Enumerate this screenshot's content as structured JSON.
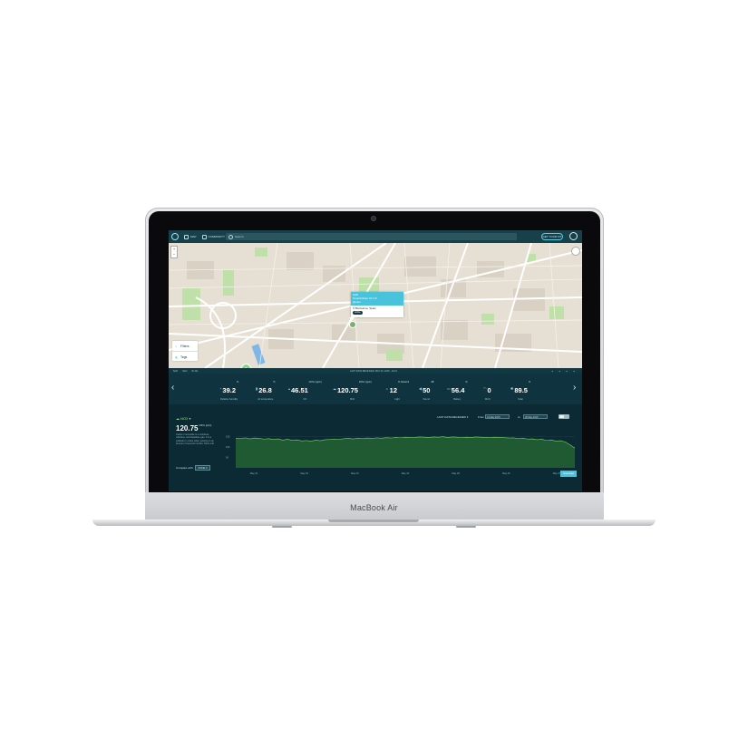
{
  "device": {
    "brand": "MacBook Air"
  },
  "app": {
    "nav": {
      "map_label": "MAP",
      "community_label": "COMMUNITY"
    },
    "search": {
      "placeholder": "Search"
    },
    "get_kit_label": "GET YOUR KIT",
    "colors": {
      "accent": "#49c2dc",
      "topbar": "#17404a",
      "panel": "#0b2a34",
      "chart_fill": "#1f5a33",
      "chart_line": "#7cd46a"
    }
  },
  "map": {
    "zoom_in": "+",
    "zoom_out": "−",
    "filters_label": "Filters",
    "tags_label": "Tags",
    "cluster_count": "6",
    "popup": {
      "name": "SoFi",
      "kit": "SmartCitizen Kit 1.5",
      "owner": "@user",
      "location": "Barcelona, Spain",
      "status": "online"
    }
  },
  "status_strip": {
    "left": [
      "SoFi",
      "SoFi",
      "ID 411"
    ],
    "center": "LAST DATA RECEIVED: MAY 20, 2015 - 10:21",
    "right": "▸ ▸ ▸ ▸"
  },
  "readings": [
    {
      "icon": "thermometer-icon",
      "value": "39.2",
      "unit": "%",
      "label": "Relative humidity"
    },
    {
      "icon": "temperature-icon",
      "value": "26.8",
      "unit": "°C",
      "label": "Air temperature"
    },
    {
      "icon": "co-icon",
      "value": "46.51",
      "unit": "kOhm (ppm)",
      "label": "CO"
    },
    {
      "icon": "no2-icon",
      "value": "120.75",
      "unit": "kOhm (ppm)",
      "label": "NO2"
    },
    {
      "icon": "light-icon",
      "value": "12",
      "unit": "% Network",
      "label": "Light"
    },
    {
      "icon": "sound-icon",
      "value": "50",
      "unit": "dB",
      "label": "Sound"
    },
    {
      "icon": "battery-icon",
      "value": "56.4",
      "unit": "%",
      "label": "Battery"
    },
    {
      "icon": "wifi-icon",
      "value": "0",
      "unit": "",
      "label": "Wi-Fi"
    },
    {
      "icon": "solar-icon",
      "value": "89.5",
      "unit": "%",
      "label": "Solar"
    }
  ],
  "detail": {
    "sensor_name": "NO2",
    "value": "120.75",
    "unit": "kOhm (ppm)",
    "description": "Carbon monoxide is a colorless, odorless, and tasteless gas. It is a pollutant in cities when existing in an amount of several months. More info",
    "compare_label": "Compare with:",
    "compare_value": "NONE",
    "range_label": "LAST DATA RECEIVED",
    "from_label": "From",
    "from_value": "21 May 2015",
    "to_label": "to",
    "to_value": "28 May 2015",
    "download_label": "Download"
  },
  "chart_data": {
    "type": "area",
    "x_ticks": [
      "May 21",
      "May 22",
      "May 23",
      "May 24",
      "May 25",
      "May 26",
      "May 27"
    ],
    "y_ticks": [
      "150",
      "100",
      "50"
    ],
    "ylim": [
      0,
      200
    ],
    "series": [
      {
        "values": [
          142,
          140,
          144,
          139,
          143,
          141,
          138,
          140,
          136,
          139,
          133,
          137,
          132,
          134,
          129,
          131,
          128,
          133,
          130,
          135,
          136,
          138,
          137,
          140,
          141,
          139,
          142,
          140,
          143,
          141,
          144,
          142,
          145,
          143,
          146,
          144,
          147,
          145,
          146,
          148,
          147,
          146,
          148,
          147,
          149,
          146,
          148,
          147,
          145,
          147,
          146,
          148,
          147,
          146,
          145,
          147,
          146,
          145,
          143,
          144,
          140,
          142,
          138,
          139,
          135,
          137,
          131,
          134,
          128,
          130,
          124,
          110,
          95
        ]
      }
    ]
  }
}
